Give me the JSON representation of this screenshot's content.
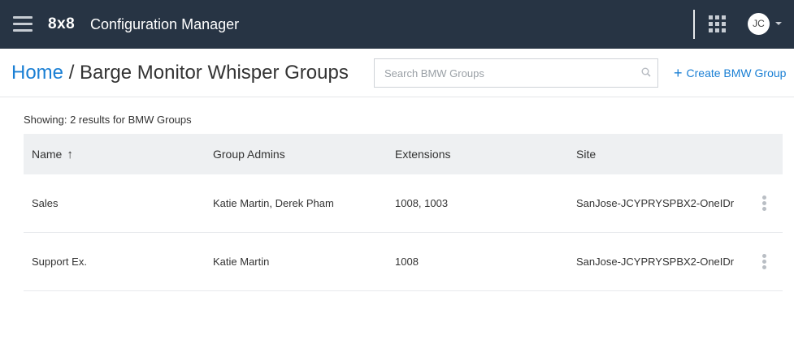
{
  "topbar": {
    "logo": "8x8",
    "app_title": "Configuration Manager",
    "user_initials": "JC",
    "icons": [
      "hamburger-menu-icon",
      "apps-grid-icon",
      "chevron-down-icon"
    ]
  },
  "header": {
    "breadcrumb_home": "Home",
    "breadcrumb_separator": "/",
    "breadcrumb_current": "Barge Monitor Whisper Groups",
    "search_placeholder": "Search BMW Groups",
    "create_button_plus": "+",
    "create_button_label": "Create BMW Group"
  },
  "results": {
    "count_text": "Showing: 2 results for BMW Groups"
  },
  "table": {
    "columns": [
      {
        "label": "Name",
        "sort": "↑"
      },
      {
        "label": "Group Admins"
      },
      {
        "label": "Extensions"
      },
      {
        "label": "Site"
      }
    ],
    "rows": [
      {
        "name": "Sales",
        "admins": "Katie Martin, Derek Pham",
        "extensions": "1008, 1003",
        "site": "SanJose-JCYPRYSPBX2-OneIDr"
      },
      {
        "name": "Support Ex.",
        "admins": "Katie Martin",
        "extensions": "1008",
        "site": "SanJose-JCYPRYSPBX2-OneIDr"
      }
    ]
  },
  "colors": {
    "topbar_bg": "#273444",
    "link": "#1a7fd4",
    "table_header_bg": "#eef0f2"
  }
}
